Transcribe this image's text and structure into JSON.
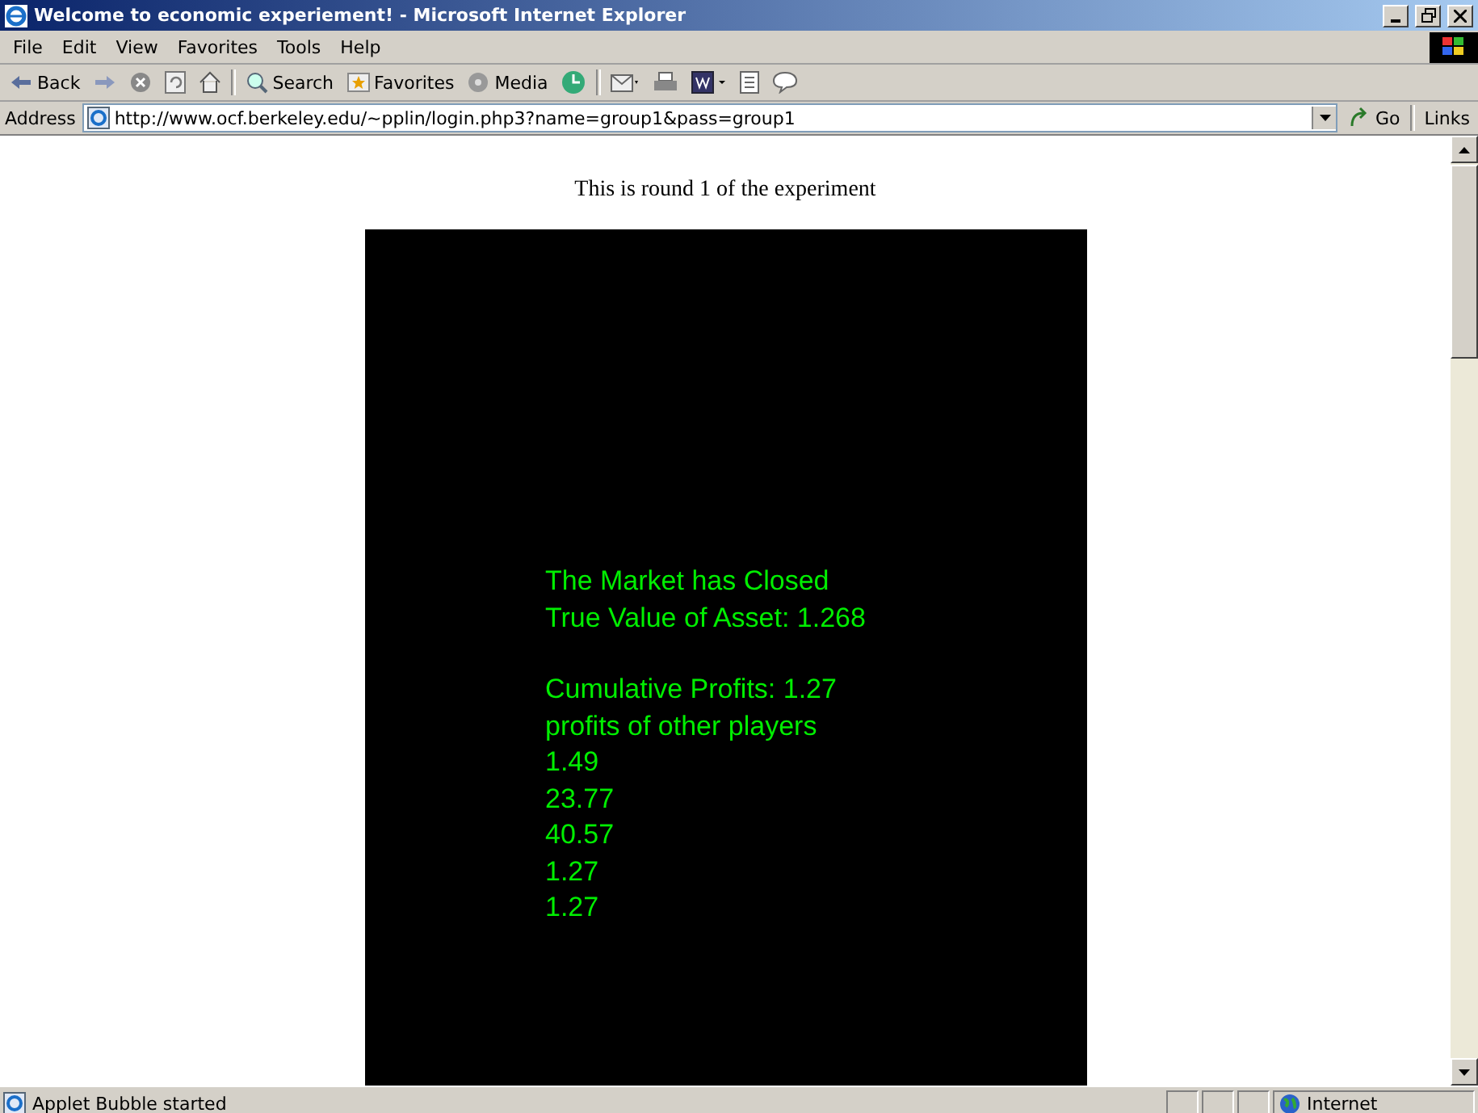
{
  "window": {
    "title": "Welcome to economic experiement! - Microsoft Internet Explorer"
  },
  "menu": [
    "File",
    "Edit",
    "View",
    "Favorites",
    "Tools",
    "Help"
  ],
  "toolbar": [
    {
      "kind": "back",
      "label": "Back"
    },
    {
      "kind": "forward"
    },
    {
      "kind": "stop"
    },
    {
      "kind": "refresh"
    },
    {
      "kind": "home"
    },
    {
      "kind": "sep"
    },
    {
      "kind": "search",
      "label": "Search"
    },
    {
      "kind": "favorites",
      "label": "Favorites"
    },
    {
      "kind": "media",
      "label": "Media"
    },
    {
      "kind": "history"
    },
    {
      "kind": "sep"
    },
    {
      "kind": "mail"
    },
    {
      "kind": "print"
    },
    {
      "kind": "word"
    },
    {
      "kind": "notes"
    },
    {
      "kind": "discuss"
    }
  ],
  "address": {
    "label": "Address",
    "value": "http://www.ocf.berkeley.edu/~pplin/login.php3?name=group1&pass=group1",
    "go": "Go",
    "links": "Links"
  },
  "page": {
    "round_text": "This is round 1 of the experiment",
    "applet": {
      "summary": [
        "The Market has Closed",
        "True Value of Asset: 1.268"
      ],
      "profits": [
        "Cumulative Profits:  1.27",
        "profits of other players",
        "1.49",
        "23.77",
        "40.57",
        "1.27",
        "1.27"
      ]
    }
  },
  "status_bar": {
    "text": "Applet Bubble started",
    "zone": "Internet"
  }
}
